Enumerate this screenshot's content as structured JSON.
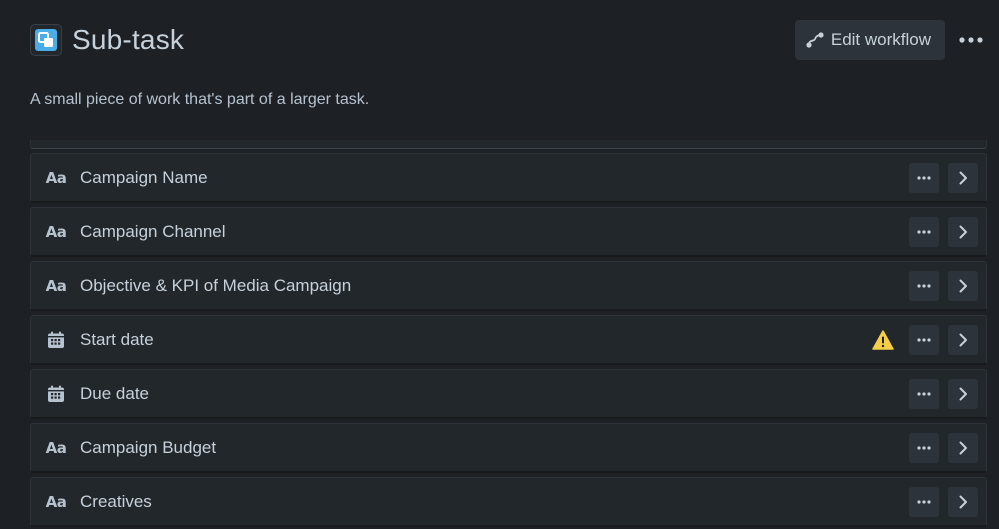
{
  "header": {
    "title": "Sub-task",
    "edit_workflow_label": "Edit workflow"
  },
  "description": "A small piece of work that's part of a larger task.",
  "fields": [
    {
      "label": "Campaign Name",
      "icon": "text-field-icon",
      "icon_glyph": "Aa",
      "warning": false
    },
    {
      "label": "Campaign Channel",
      "icon": "text-field-icon",
      "icon_glyph": "Aa",
      "warning": false
    },
    {
      "label": "Objective & KPI of Media Campaign",
      "icon": "text-field-icon",
      "icon_glyph": "Aa",
      "warning": false
    },
    {
      "label": "Start date",
      "icon": "calendar-icon",
      "icon_glyph": "",
      "warning": true
    },
    {
      "label": "Due date",
      "icon": "calendar-icon",
      "icon_glyph": "",
      "warning": false
    },
    {
      "label": "Campaign Budget",
      "icon": "text-field-icon",
      "icon_glyph": "Aa",
      "warning": false
    },
    {
      "label": "Creatives",
      "icon": "text-field-icon",
      "icon_glyph": "Aa",
      "warning": false
    }
  ],
  "colors": {
    "background": "#1d2125",
    "row": "#22272b",
    "button": "#2c333a",
    "text": "#c7d1db",
    "subtask_icon": "#4bade8",
    "warning": "#f5cd47"
  }
}
